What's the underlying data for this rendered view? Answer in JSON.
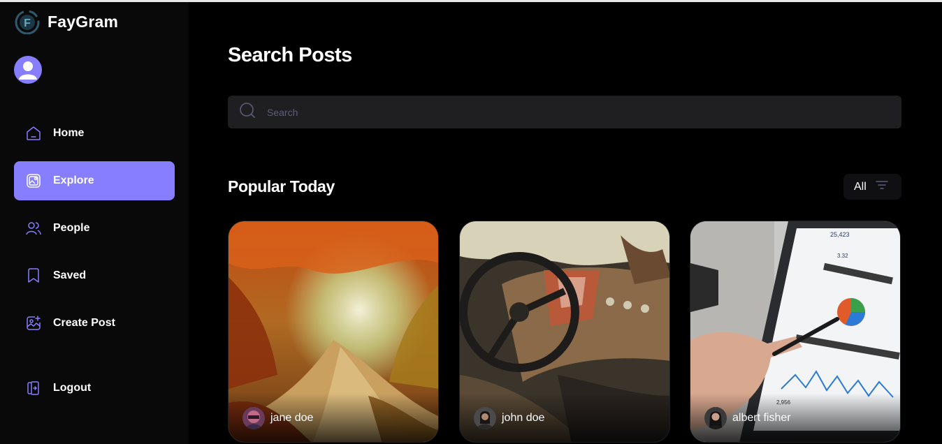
{
  "app": {
    "name": "FayGram"
  },
  "sidebar": {
    "items": [
      {
        "label": "Home",
        "icon": "home-icon",
        "active": false
      },
      {
        "label": "Explore",
        "icon": "explore-icon",
        "active": true
      },
      {
        "label": "People",
        "icon": "people-icon",
        "active": false
      },
      {
        "label": "Saved",
        "icon": "bookmark-icon",
        "active": false
      },
      {
        "label": "Create Post",
        "icon": "gallery-add-icon",
        "active": false
      }
    ],
    "logout_label": "Logout"
  },
  "main": {
    "title": "Search Posts",
    "search_placeholder": "Search",
    "section_title": "Popular Today",
    "filter_label": "All",
    "posts": [
      {
        "author": "jane doe"
      },
      {
        "author": "john doe"
      },
      {
        "author": "albert fisher"
      }
    ]
  },
  "colors": {
    "accent": "#877eff",
    "background": "#000000",
    "sidebar_bg": "#09090a",
    "input_bg": "#1f1f22",
    "placeholder": "#5c5c7b"
  }
}
